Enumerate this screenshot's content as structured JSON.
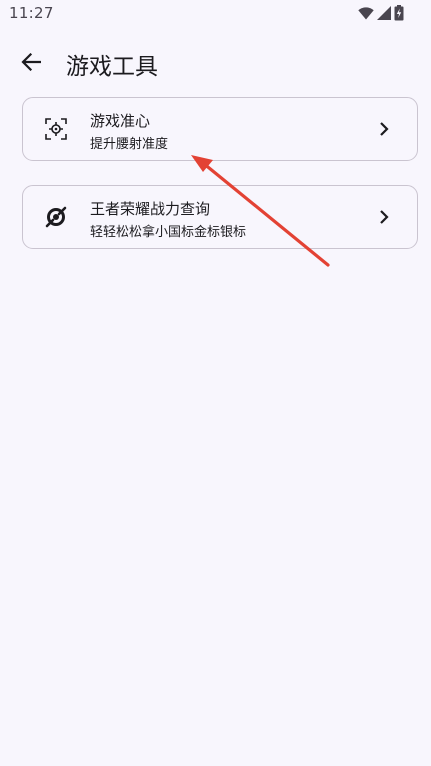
{
  "status_bar": {
    "time": "11:27",
    "icons": [
      "wifi-icon",
      "signal-icon",
      "battery-charging-icon"
    ]
  },
  "app_bar": {
    "title": "游戏工具",
    "back_icon": "arrow-left-icon"
  },
  "tools": [
    {
      "title": "游戏准心",
      "subtitle": "提升腰射准度",
      "icon": "crosshair-focus-icon"
    },
    {
      "title": "王者荣耀战力查询",
      "subtitle": "轻轻松松拿小国标金标银标",
      "icon": "target-swirl-icon"
    }
  ],
  "annotation": {
    "color": "#e34234"
  }
}
